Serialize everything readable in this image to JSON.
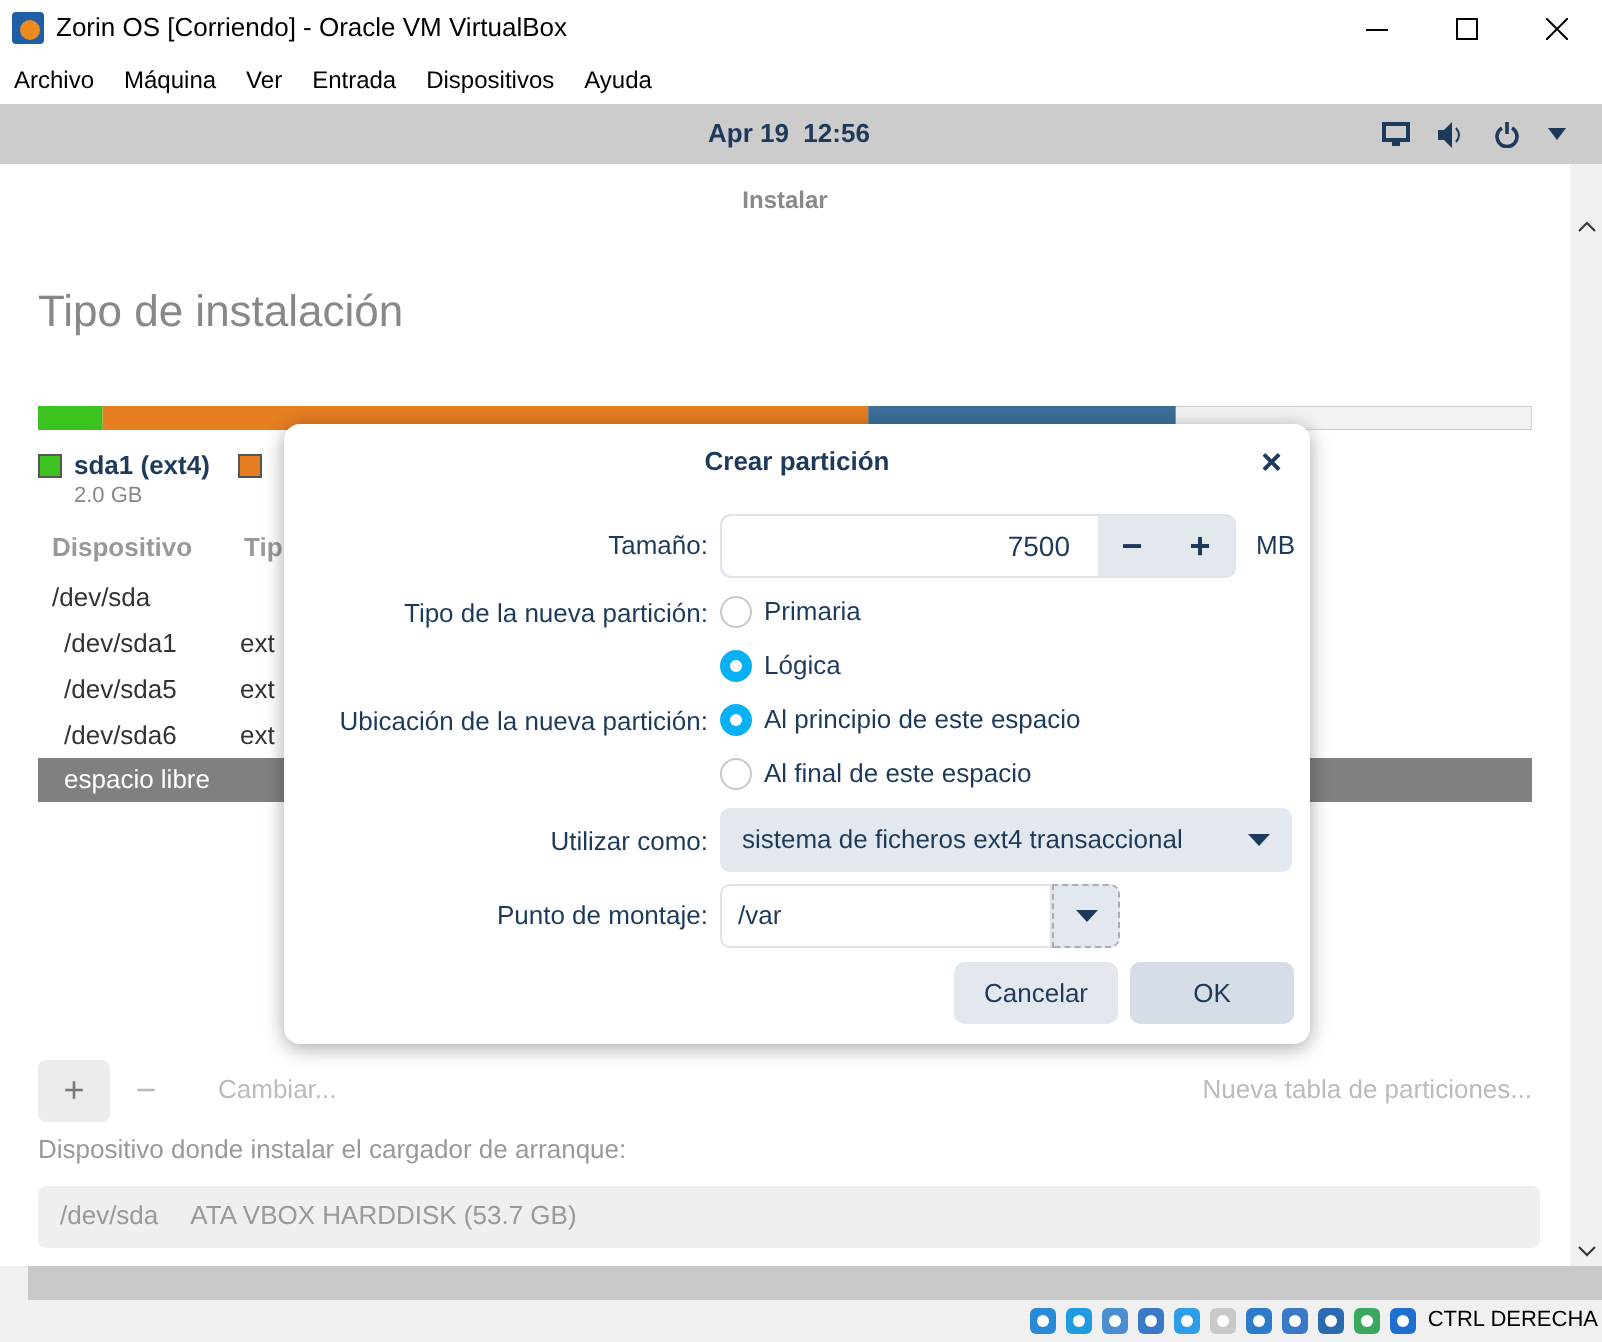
{
  "window": {
    "title": "Zorin OS [Corriendo] - Oracle VM VirtualBox"
  },
  "menu": [
    "Archivo",
    "Máquina",
    "Ver",
    "Entrada",
    "Dispositivos",
    "Ayuda"
  ],
  "top_bar": {
    "clock": "Apr 19  12:56"
  },
  "installer": {
    "header": "Instalar",
    "heading": "Tipo de instalación",
    "legend": [
      {
        "label": "sda1 (ext4)",
        "size": "2.0 GB",
        "color": "#3cc21f"
      },
      {
        "color": "#e67e22"
      }
    ],
    "table": {
      "columns": [
        "Dispositivo",
        "Tip"
      ],
      "rows": [
        {
          "device": "/dev/sda",
          "selected": false,
          "children": [
            {
              "device": "/dev/sda1",
              "type": "ext",
              "selected": false
            },
            {
              "device": "/dev/sda5",
              "type": "ext",
              "selected": false
            },
            {
              "device": "/dev/sda6",
              "type": "ext",
              "selected": false
            },
            {
              "device": "espacio libre",
              "selected": true
            }
          ]
        }
      ]
    },
    "toolbar": {
      "add": "+",
      "remove": "−",
      "change": "Cambiar...",
      "new_table": "Nueva tabla de particiones..."
    },
    "bootloader_label": "Dispositivo donde instalar el cargador de arranque:",
    "bootloader": {
      "device": "/dev/sda",
      "name": "ATA VBOX HARDDISK (53.7 GB)"
    }
  },
  "dialog": {
    "title": "Crear partición",
    "close": "×",
    "size_label": "Tamaño:",
    "size_value": "7500",
    "decrement": "−",
    "increment": "+",
    "unit": "MB",
    "type_label": "Tipo de la nueva partición:",
    "type_options": [
      {
        "label": "Primaria",
        "selected": false
      },
      {
        "label": "Lógica",
        "selected": true
      }
    ],
    "location_label": "Ubicación de la nueva partición:",
    "location_options": [
      {
        "label": "Al principio de este espacio",
        "selected": true
      },
      {
        "label": "Al final de este espacio",
        "selected": false
      }
    ],
    "use_label": "Utilizar como:",
    "use_value": "sistema de ficheros ext4 transaccional",
    "mount_label": "Punto de montaje:",
    "mount_value": "/var",
    "buttons": [
      "Cancelar",
      "OK"
    ]
  },
  "status_bar": {
    "host_key": "CTRL DERECHA"
  }
}
